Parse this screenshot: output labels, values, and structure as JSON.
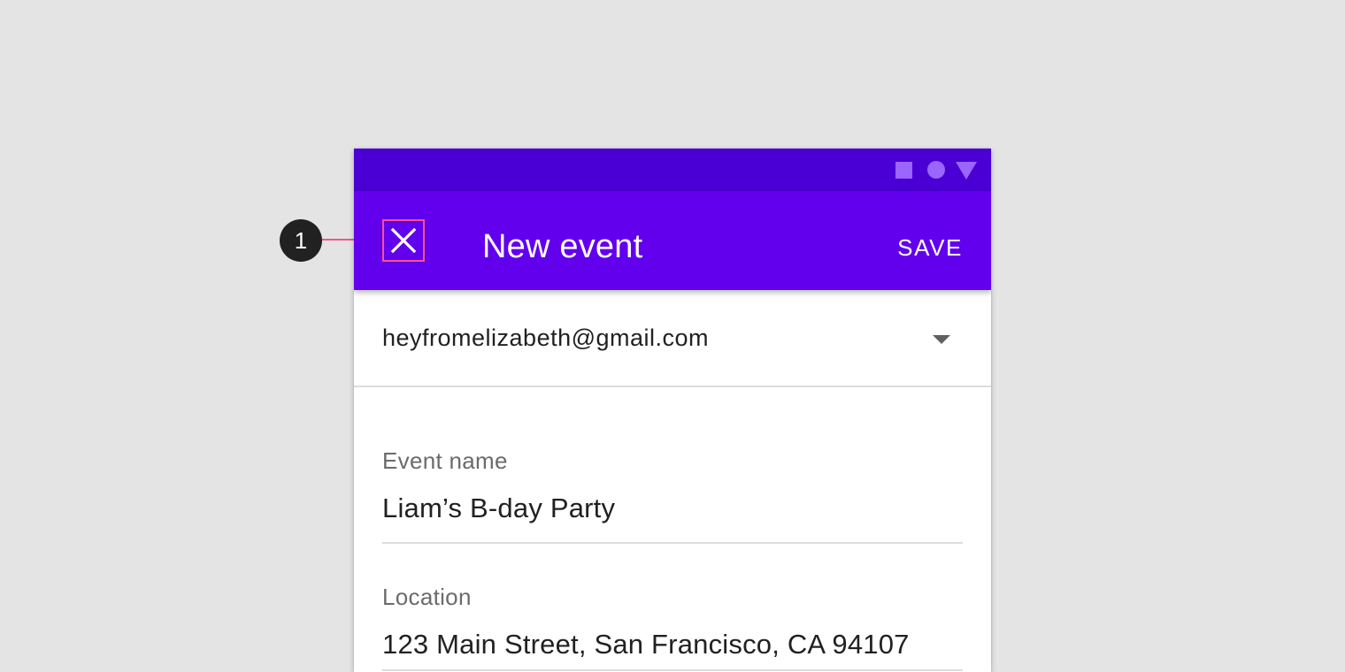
{
  "annotation": {
    "marker_number": "1"
  },
  "colors": {
    "background": "#e4e4e4",
    "status_bar": "#4a00d4",
    "app_bar": "#6200ee",
    "status_icons": "#9a66ff",
    "callout_highlight": "#ff4f8a"
  },
  "status_bar": {
    "icons": [
      "square-icon",
      "circle-icon",
      "triangle-icon"
    ]
  },
  "app_bar": {
    "nav_icon": "close-icon",
    "title": "New event",
    "action_label": "SAVE"
  },
  "account": {
    "email": "heyfromelizabeth@gmail.com",
    "icon": "dropdown-arrow-icon"
  },
  "form": {
    "fields": [
      {
        "label": "Event name",
        "value": "Liam’s B-day Party"
      },
      {
        "label": "Location",
        "value": "123 Main Street, San Francisco, CA 94107"
      }
    ]
  }
}
